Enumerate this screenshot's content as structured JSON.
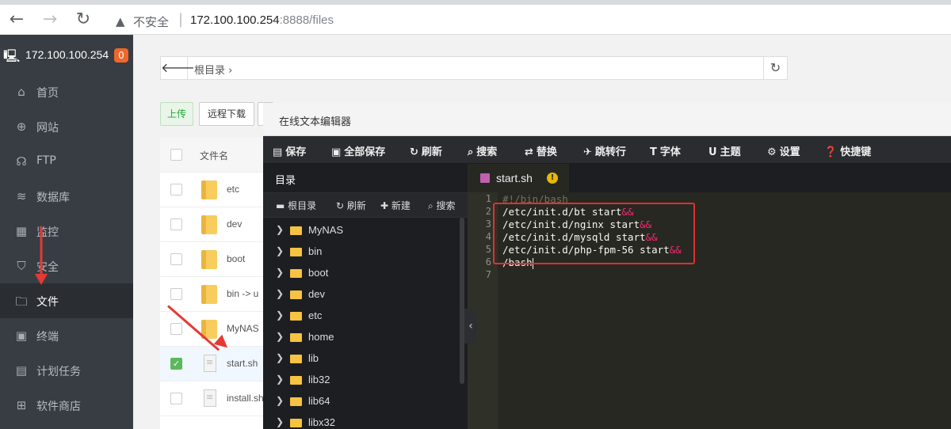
{
  "browser": {
    "back": "←",
    "forward": "→",
    "reload": "↻",
    "insecure_label": "不安全",
    "url_host": "172.100.100.254",
    "url_path": ":8888/files"
  },
  "sidebar": {
    "server_ip": "172.100.100.254",
    "badge": "0",
    "items": [
      {
        "label": "首页",
        "icon": "home-icon"
      },
      {
        "label": "网站",
        "icon": "globe-icon"
      },
      {
        "label": "FTP",
        "icon": "ftp-icon"
      },
      {
        "label": "数据库",
        "icon": "database-icon"
      },
      {
        "label": "监控",
        "icon": "monitor-icon"
      },
      {
        "label": "安全",
        "icon": "shield-icon"
      },
      {
        "label": "文件",
        "icon": "folder-icon"
      },
      {
        "label": "终端",
        "icon": "terminal-icon"
      },
      {
        "label": "计划任务",
        "icon": "calendar-icon"
      },
      {
        "label": "软件商店",
        "icon": "apps-icon"
      }
    ]
  },
  "main": {
    "path_root": "根目录 ›",
    "upload": "上传",
    "remote_download": "远程下载",
    "col_filename": "文件名",
    "files": [
      "etc",
      "dev",
      "boot",
      "bin -> u",
      "MyNAS",
      "start.sh",
      "install.sh"
    ]
  },
  "editor": {
    "title": "在线文本编辑器",
    "toolbar": [
      "保存",
      "全部保存",
      "刷新",
      "搜索",
      "替换",
      "跳转行",
      "字体",
      "主题",
      "设置",
      "快捷键"
    ],
    "tree_title": "目录",
    "tree_tools": [
      "根目录",
      "刷新",
      "新建",
      "搜索"
    ],
    "tree_items": [
      "MyNAS",
      "bin",
      "boot",
      "dev",
      "etc",
      "home",
      "lib",
      "lib32",
      "lib64",
      "libx32"
    ],
    "tab_name": "start.sh",
    "line_numbers": [
      "1",
      "2",
      "3",
      "4",
      "5",
      "6",
      "7"
    ],
    "code": {
      "l1": "#!/bin/bash",
      "l2": "/etc/init.d/bt start",
      "l3": "/etc/init.d/nginx start",
      "l4": "/etc/init.d/mysqld start",
      "l5": "/etc/init.d/php-fpm-56 start",
      "l6": "/bash",
      "op": "&&"
    }
  }
}
